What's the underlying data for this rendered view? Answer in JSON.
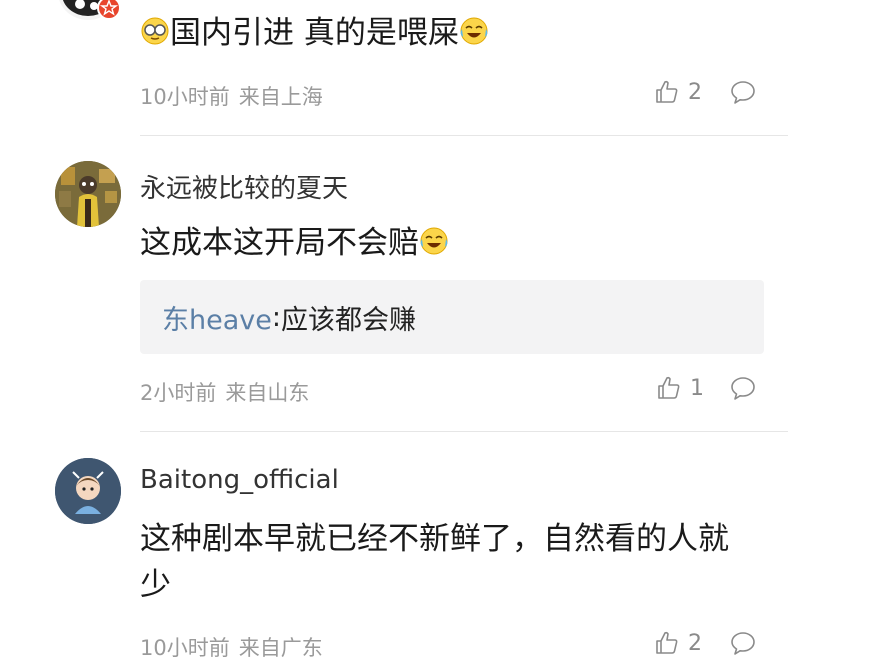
{
  "comments": [
    {
      "text": "国内引进 真的是喂屎",
      "time": "10小时前",
      "location": "来自上海",
      "likes": "2"
    },
    {
      "username": "永远被比较的夏天",
      "text": "这成本这开局不会赔",
      "reply": {
        "name": "东heave",
        "colon": ":",
        "text": "应该都会赚"
      },
      "time": "2小时前",
      "location": "来自山东",
      "likes": "1"
    },
    {
      "username": "Baitong_official",
      "text": "这种剧本早就已经不新鲜了，自然看的人就少",
      "time": "10小时前",
      "location": "来自广东",
      "likes": "2"
    }
  ],
  "colors": {
    "reply_name": "#5b7fa6",
    "meta": "#9a9a9a",
    "reply_bg": "#f3f3f4",
    "badge": "#e8452c"
  },
  "icons": [
    "thumbs-up-icon",
    "comment-bubble-icon",
    "face-emoji-icon",
    "laugh-cry-emoji-icon",
    "vip-badge-icon"
  ]
}
